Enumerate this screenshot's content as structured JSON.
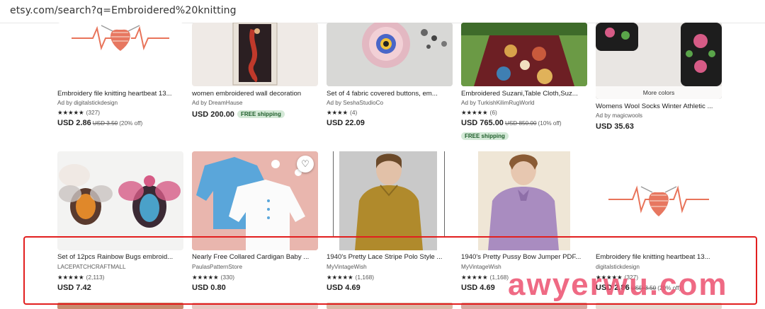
{
  "browser": {
    "url": "etsy.com/search?q=Embroidered%20knitting"
  },
  "free_shipping": "FREE shipping",
  "more_colors": "More colors",
  "watermark": "awyerwu.com",
  "row1": [
    {
      "title": "Embroidery file knitting heartbeat 13...",
      "seller": "Ad by digitalstickdesign",
      "stars": "★★★★★",
      "count": "(327)",
      "price": "USD 2.86",
      "old_price": "USD 3.50",
      "discount": "(20% off)",
      "free_shipping": false
    },
    {
      "title": "women embroidered wall decoration",
      "seller": "Ad by DreamHause",
      "stars": "",
      "count": "",
      "price": "USD 200.00",
      "old_price": "",
      "discount": "",
      "free_shipping": true
    },
    {
      "title": "Set of 4 fabric covered buttons, em...",
      "seller": "Ad by SeshaStudioCo",
      "stars": "★★★★",
      "count": "(4)",
      "price": "USD 22.09",
      "old_price": "",
      "discount": "",
      "free_shipping": false
    },
    {
      "title": "Embroidered Suzani,Table Cloth,Suz...",
      "seller": "Ad by TurkishKilimRugWorld",
      "stars": "★★★★★",
      "count": "(6)",
      "price": "USD 765.00",
      "old_price": "USD 850.00",
      "discount": "(10% off)",
      "free_shipping": true
    },
    {
      "title": "Womens Wool Socks Winter Athletic ...",
      "seller": "Ad by magicwools",
      "stars": "",
      "count": "",
      "price": "USD 35.63",
      "old_price": "",
      "discount": "",
      "free_shipping": false
    }
  ],
  "row2": [
    {
      "title": "Set of 12pcs Rainbow Bugs embroid...",
      "seller": "LACEPATCHCRAFTMALL",
      "stars": "★★★★★",
      "count": "(2,113)",
      "price": "USD 7.42",
      "old_price": "",
      "discount": ""
    },
    {
      "title": "Nearly Free Collared Cardigan Baby ...",
      "seller": "PaulasPatternStore",
      "stars": "★★★★★",
      "count": "(330)",
      "price": "USD 0.80",
      "old_price": "",
      "discount": ""
    },
    {
      "title": "1940's Pretty Lace Stripe Polo Style ...",
      "seller": "MyVintageWish",
      "stars": "★★★★★",
      "count": "(1,168)",
      "price": "USD 4.69",
      "old_price": "",
      "discount": ""
    },
    {
      "title": "1940's Pretty Pussy Bow Jumper PDF...",
      "seller": "MyVintageWish",
      "stars": "★★★★★",
      "count": "(1,168)",
      "price": "USD 4.69",
      "old_price": "",
      "discount": ""
    },
    {
      "title": "Embroidery file knitting heartbeat 13...",
      "seller": "digitalstickdesign",
      "stars": "★★★★★",
      "count": "(327)",
      "price": "USD 2.86",
      "old_price": "USD 3.50",
      "discount": "(20% off)"
    }
  ],
  "icons": {
    "favorite": "heart-icon"
  }
}
